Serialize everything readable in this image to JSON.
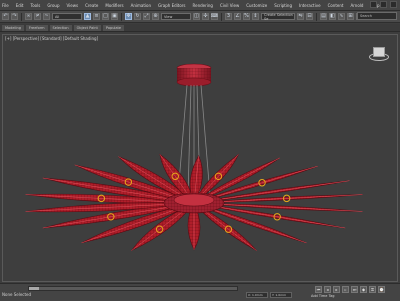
{
  "menubar": {
    "items": [
      "File",
      "Edit",
      "Tools",
      "Group",
      "Views",
      "Create",
      "Modifiers",
      "Animation",
      "Graph Editors",
      "Rendering",
      "Civil View",
      "Customize",
      "Scripting",
      "Interactive",
      "Content",
      "Arnold",
      "Help"
    ]
  },
  "toolbar": {
    "selection_filter": "All",
    "view_select": "View",
    "selection_set": "Create Selection Se"
  },
  "search": {
    "placeholder": "Search"
  },
  "ribbon": {
    "tabs": [
      "Modeling",
      "Freeform",
      "Selection",
      "Object Paint",
      "Populate"
    ]
  },
  "viewport": {
    "label": "[+] [Perspective] [Standard] [Default Shading]"
  },
  "status": {
    "text": "None Selected",
    "x_field": "X: 1.0mm",
    "y_field": "Y: 1.0mm",
    "auto_key": "Add Time Tag"
  },
  "colors": {
    "mesh": "#b01e2a",
    "mesh_light": "#e05560",
    "wire": "#7a0f18",
    "accent": "#e6a91b"
  }
}
